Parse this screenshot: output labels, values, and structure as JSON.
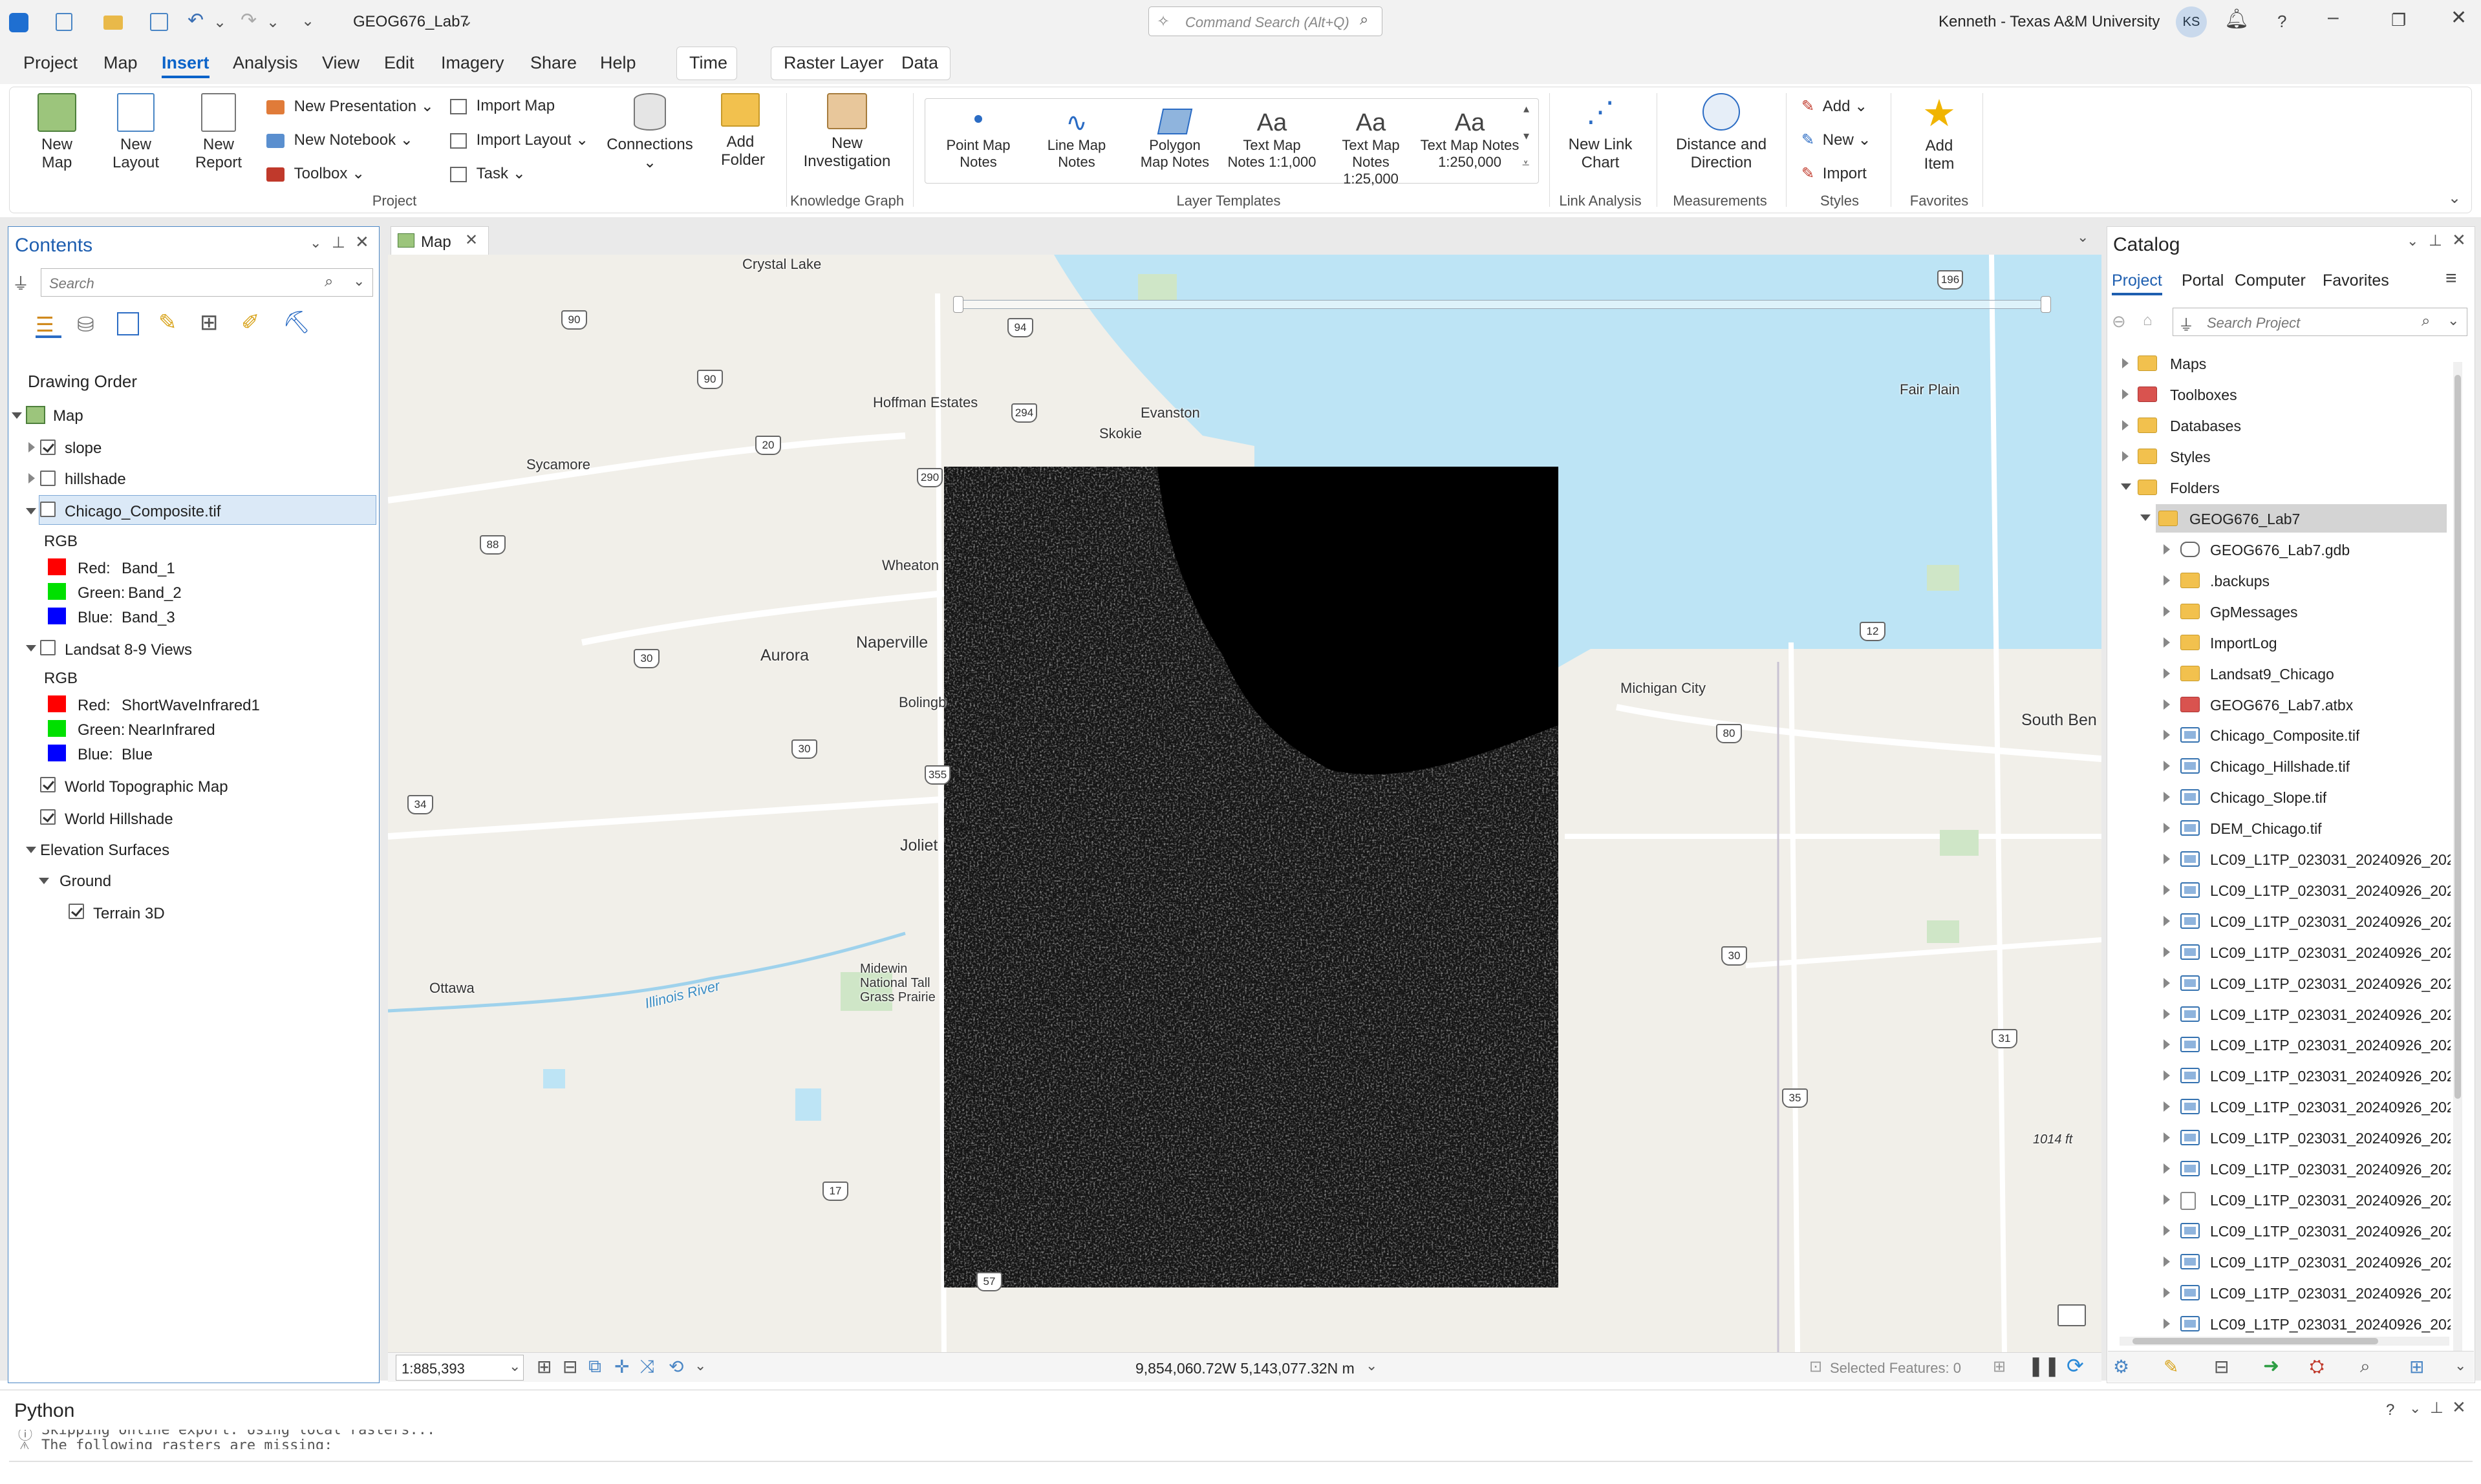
{
  "app": {
    "project_name": "GEOG676_Lab7",
    "command_search_placeholder": "Command Search (Alt+Q)",
    "user_name": "Kenneth - Texas A&M University",
    "user_initials": "KS",
    "help_label": "?"
  },
  "menu": {
    "items": [
      "Project",
      "Map",
      "Insert",
      "Analysis",
      "View",
      "Edit",
      "Imagery",
      "Share",
      "Help"
    ],
    "active": "Insert",
    "contextual_time": "Time",
    "contextual_raster": "Raster Layer",
    "contextual_data": "Data"
  },
  "ribbon": {
    "new_map": "New Map",
    "new_layout": "New Layout",
    "new_report": "New Report",
    "new_presentation": "New Presentation",
    "new_notebook": "New Notebook",
    "toolbox": "Toolbox",
    "import_map": "Import Map",
    "import_layout": "Import Layout",
    "task": "Task",
    "connections": "Connections",
    "add_folder": "Add Folder",
    "group_project": "Project",
    "new_investigation": "New Investigation",
    "group_knowledge_graph": "Knowledge Graph",
    "layer_templates": [
      {
        "line1": "Point Map",
        "line2": "Notes"
      },
      {
        "line1": "Line Map",
        "line2": "Notes"
      },
      {
        "line1": "Polygon",
        "line2": "Map Notes"
      },
      {
        "line1": "Text Map",
        "line2": "Notes 1:1,000"
      },
      {
        "line1": "Text Map",
        "line2": "Notes 1:25,000"
      },
      {
        "line1": "Text Map Notes",
        "line2": "1:250,000"
      }
    ],
    "group_layer_templates": "Layer Templates",
    "new_link_chart": "New Link Chart",
    "group_link_analysis": "Link Analysis",
    "distance_direction": "Distance and Direction",
    "group_measurements": "Measurements",
    "styles_add": "Add",
    "styles_new": "New",
    "styles_import": "Import",
    "group_styles": "Styles",
    "add_item": "Add Item",
    "group_favorites": "Favorites"
  },
  "contents": {
    "title": "Contents",
    "search_placeholder": "Search",
    "drawing_order": "Drawing Order",
    "map_label": "Map",
    "layers": [
      {
        "name": "slope",
        "checked": true
      },
      {
        "name": "hillshade",
        "checked": false
      },
      {
        "name": "Chicago_Composite.tif",
        "checked": false,
        "selected": true
      }
    ],
    "composite_legend": {
      "type": "RGB",
      "bands": [
        {
          "channel": "Red:",
          "value": "Band_1",
          "color": "#ff0000"
        },
        {
          "channel": "Green:",
          "value": "Band_2",
          "color": "#00e000"
        },
        {
          "channel": "Blue:",
          "value": "Band_3",
          "color": "#0000ff"
        }
      ]
    },
    "landsat_layer": "Landsat 8-9 Views",
    "landsat_legend": {
      "type": "RGB",
      "bands": [
        {
          "channel": "Red:",
          "value": "ShortWaveInfrared1",
          "color": "#ff0000"
        },
        {
          "channel": "Green:",
          "value": "NearInfrared",
          "color": "#00e000"
        },
        {
          "channel": "Blue:",
          "value": "Blue",
          "color": "#0000ff"
        }
      ]
    },
    "basemaps": [
      {
        "name": "World Topographic Map",
        "checked": true
      },
      {
        "name": "World Hillshade",
        "checked": true
      }
    ],
    "elevation_surfaces": "Elevation Surfaces",
    "ground": "Ground",
    "terrain": "Terrain 3D"
  },
  "map_view": {
    "tab_label": "Map",
    "scale": "1:885,393",
    "coordinates": "9,854,060.72W 5,143,077.32N m",
    "selected_features": "Selected Features: 0",
    "place_labels": [
      "Crystal Lake",
      "Hoffman Estates",
      "Evanston",
      "Skokie",
      "Sycamore",
      "Wheaton",
      "Naperville",
      "Aurora",
      "Bolingb",
      "Joliet",
      "Ottawa",
      "Midewin National Tall Grass Prairie",
      "Illinois River",
      "Fair Plain",
      "Michigan City",
      "South Ben",
      "1014 ft"
    ],
    "route_shields": [
      "90",
      "94",
      "90",
      "294",
      "20",
      "290",
      "88",
      "30",
      "30",
      "355",
      "34",
      "17",
      "57",
      "196",
      "12",
      "80",
      "30",
      "31",
      "35"
    ]
  },
  "catalog": {
    "title": "Catalog",
    "tabs": [
      "Project",
      "Portal",
      "Computer",
      "Favorites"
    ],
    "active_tab": "Project",
    "search_placeholder": "Search Project",
    "top_items": [
      "Maps",
      "Toolboxes",
      "Databases",
      "Styles",
      "Folders"
    ],
    "project_folder": "GEOG676_Lab7",
    "children": [
      {
        "name": "GEOG676_Lab7.gdb",
        "icon": "geodatabase-icon"
      },
      {
        "name": ".backups",
        "icon": "folder-icon"
      },
      {
        "name": "GpMessages",
        "icon": "folder-icon"
      },
      {
        "name": "ImportLog",
        "icon": "folder-icon"
      },
      {
        "name": "Landsat9_Chicago",
        "icon": "folder-icon"
      },
      {
        "name": "GEOG676_Lab7.atbx",
        "icon": "toolbox-icon"
      },
      {
        "name": "Chicago_Composite.tif",
        "icon": "raster-icon"
      },
      {
        "name": "Chicago_Hillshade.tif",
        "icon": "raster-icon"
      },
      {
        "name": "Chicago_Slope.tif",
        "icon": "raster-icon"
      },
      {
        "name": "DEM_Chicago.tif",
        "icon": "raster-icon"
      },
      {
        "name": "LC09_L1TP_023031_20240926_202",
        "icon": "raster-icon"
      },
      {
        "name": "LC09_L1TP_023031_20240926_202",
        "icon": "raster-icon"
      },
      {
        "name": "LC09_L1TP_023031_20240926_202",
        "icon": "raster-icon"
      },
      {
        "name": "LC09_L1TP_023031_20240926_202",
        "icon": "raster-icon"
      },
      {
        "name": "LC09_L1TP_023031_20240926_202",
        "icon": "raster-icon"
      },
      {
        "name": "LC09_L1TP_023031_20240926_202",
        "icon": "raster-icon"
      },
      {
        "name": "LC09_L1TP_023031_20240926_202",
        "icon": "raster-icon"
      },
      {
        "name": "LC09_L1TP_023031_20240926_202",
        "icon": "raster-icon"
      },
      {
        "name": "LC09_L1TP_023031_20240926_202",
        "icon": "raster-icon"
      },
      {
        "name": "LC09_L1TP_023031_20240926_202",
        "icon": "raster-icon"
      },
      {
        "name": "LC09_L1TP_023031_20240926_202",
        "icon": "raster-icon"
      },
      {
        "name": "LC09_L1TP_023031_20240926_202",
        "icon": "file-icon"
      },
      {
        "name": "LC09_L1TP_023031_20240926_202",
        "icon": "raster-icon"
      },
      {
        "name": "LC09_L1TP_023031_20240926_202",
        "icon": "raster-icon"
      },
      {
        "name": "LC09_L1TP_023031_20240926_202",
        "icon": "raster-icon"
      },
      {
        "name": "LC09_L1TP_023031_20240926_202",
        "icon": "raster-icon"
      }
    ]
  },
  "python": {
    "title": "Python",
    "help": "?",
    "console_line_1": "Skipping online export. Using local rasters...",
    "console_line_2": "The following rasters are missing:"
  },
  "colors": {
    "accent": "#0b63c9",
    "water": "#bde4f5",
    "land": "#f1efe9",
    "selected_row": "#dbe9f7",
    "raster_black": "#000000"
  }
}
